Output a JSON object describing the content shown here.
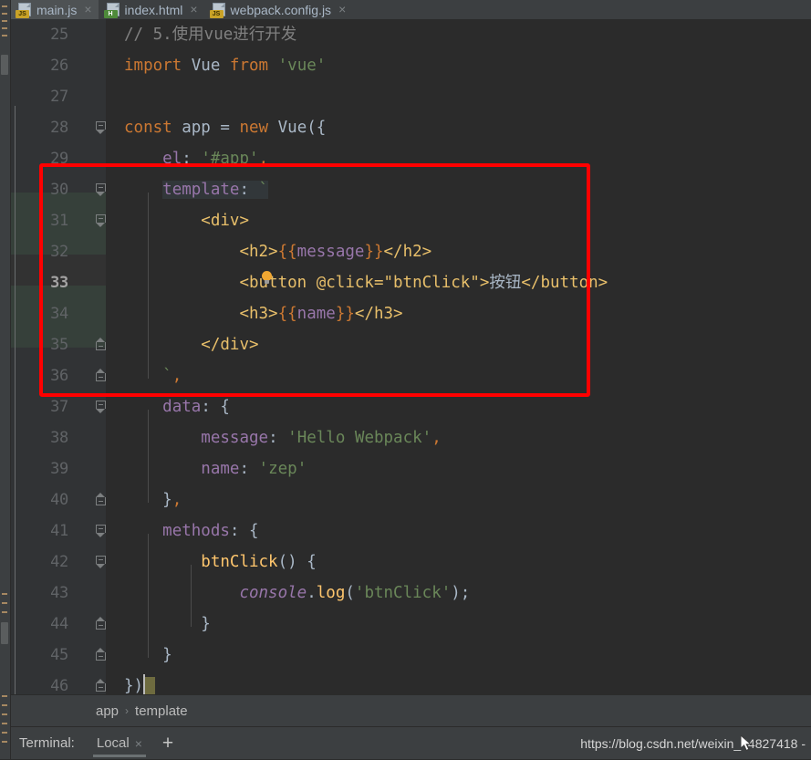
{
  "window": {
    "theme_bg": "#2b2b2b",
    "panel_bg": "#3c3f41",
    "accent_red": "#ff0000",
    "added_line_bg": "#36403a"
  },
  "tabs": [
    {
      "label": "main.js",
      "icon": "js-file-icon",
      "badge": "JS",
      "active": true,
      "close": "×"
    },
    {
      "label": "index.html",
      "icon": "html-file-icon",
      "badge": "H",
      "active": false,
      "close": "×"
    },
    {
      "label": "webpack.config.js",
      "icon": "js-file-icon",
      "badge": "JS",
      "active": false,
      "close": "×"
    }
  ],
  "editor": {
    "first_line": 25,
    "last_line": 46,
    "current_line": 33,
    "line_height": 34,
    "lines": [
      {
        "n": 25,
        "text": "// 5.使用vue进行开发"
      },
      {
        "n": 26,
        "text": "import Vue from 'vue'"
      },
      {
        "n": 27,
        "text": ""
      },
      {
        "n": 28,
        "text": "const app = new Vue({"
      },
      {
        "n": 29,
        "text": "    el: '#app',"
      },
      {
        "n": 30,
        "text": "    template: `"
      },
      {
        "n": 31,
        "text": "        <div>"
      },
      {
        "n": 32,
        "text": "            <h2>{{message}}</h2>"
      },
      {
        "n": 33,
        "text": "            <button @click=\"btnClick\">按钮</button>"
      },
      {
        "n": 34,
        "text": "            <h3>{{name}}</h3>"
      },
      {
        "n": 35,
        "text": "        </div>"
      },
      {
        "n": 36,
        "text": "    `,"
      },
      {
        "n": 37,
        "text": "    data: {"
      },
      {
        "n": 38,
        "text": "        message: 'Hello Webpack',"
      },
      {
        "n": 39,
        "text": "        name: 'zep'"
      },
      {
        "n": 40,
        "text": "    },"
      },
      {
        "n": 41,
        "text": "    methods: {"
      },
      {
        "n": 42,
        "text": "        btnClick() {"
      },
      {
        "n": 43,
        "text": "            console.log('btnClick');"
      },
      {
        "n": 44,
        "text": "        }"
      },
      {
        "n": 45,
        "text": "    }"
      },
      {
        "n": 46,
        "text": "})"
      }
    ],
    "annotation": {
      "type": "red-rectangle",
      "covers_lines": "30-36",
      "color": "#ff0000"
    },
    "intention_bulb": "lightbulb-icon"
  },
  "breadcrumb": {
    "items": [
      "app",
      "template"
    ],
    "separator": "›"
  },
  "terminal": {
    "label": "Terminal:",
    "tab": "Local",
    "close": "×",
    "add": "+"
  },
  "watermark": {
    "text": "https://blog.csdn.net/weixin_44827418 -"
  }
}
